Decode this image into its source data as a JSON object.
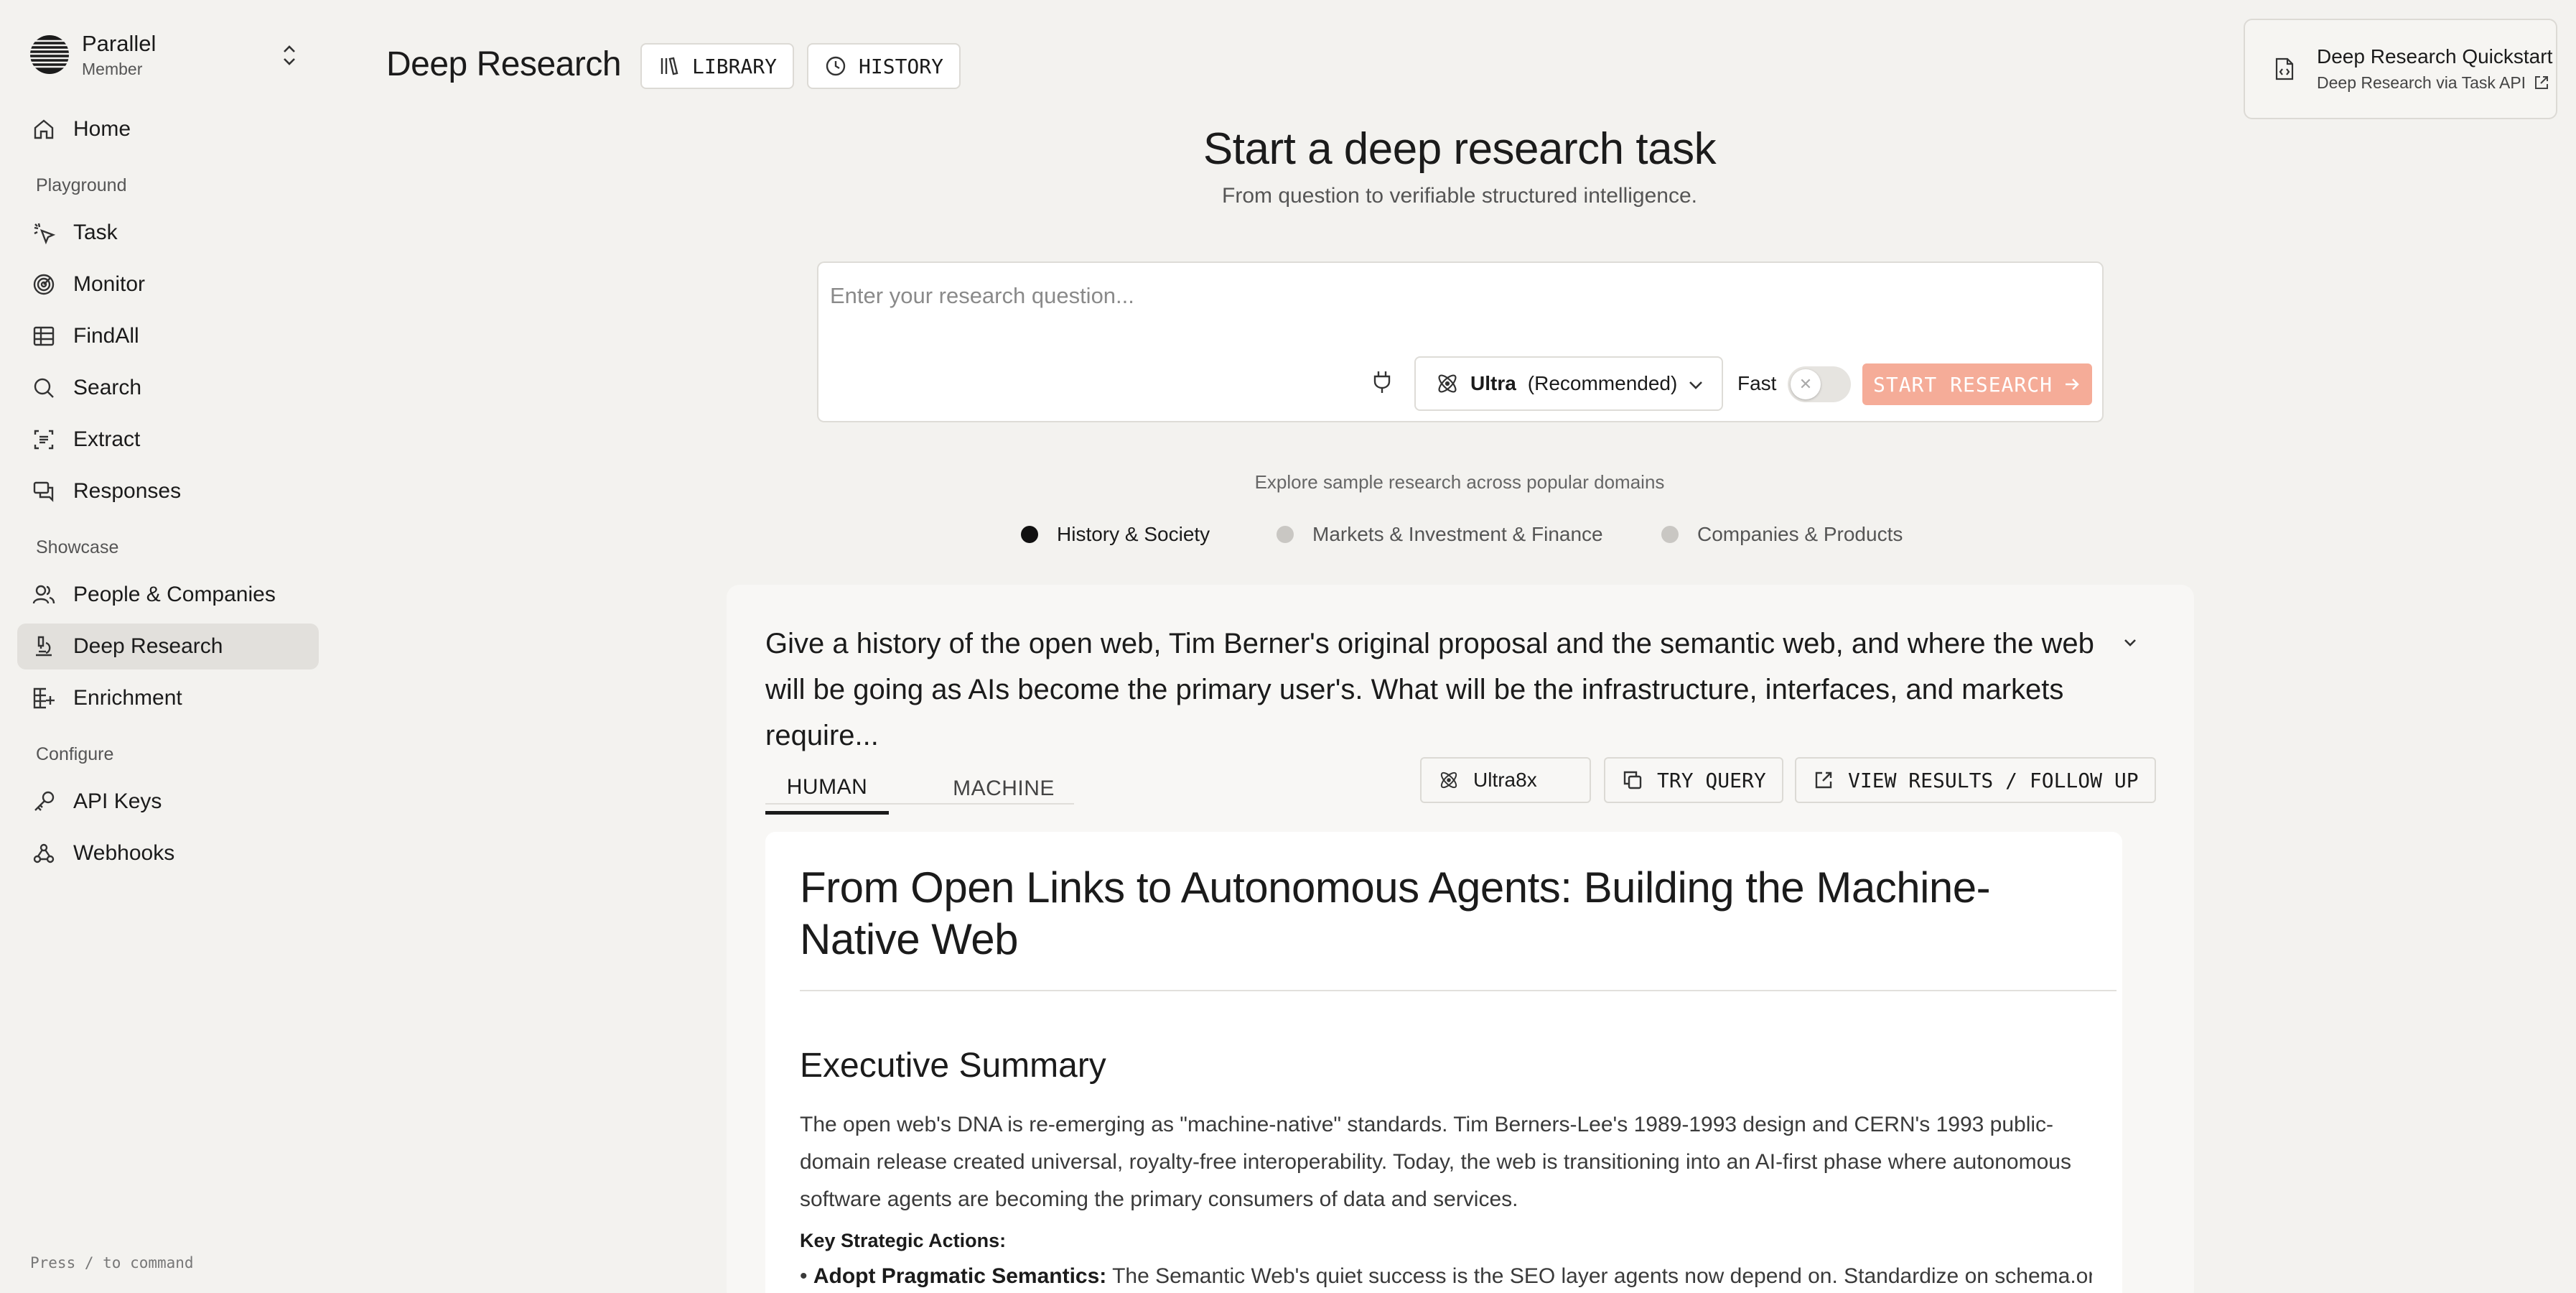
{
  "org": {
    "name": "Parallel",
    "role": "Member"
  },
  "nav": {
    "home": "Home",
    "playground_label": "Playground",
    "task": "Task",
    "monitor": "Monitor",
    "findall": "FindAll",
    "search": "Search",
    "extract": "Extract",
    "responses": "Responses",
    "showcase_label": "Showcase",
    "people": "People & Companies",
    "deep_research": "Deep Research",
    "enrichment": "Enrichment",
    "configure_label": "Configure",
    "api_keys": "API Keys",
    "webhooks": "Webhooks"
  },
  "command_hint": "Press / to command",
  "header": {
    "title": "Deep Research",
    "library": "LIBRARY",
    "history": "HISTORY"
  },
  "quickstart": {
    "title": "Deep Research Quickstart",
    "subtitle": "Deep Research via Task API"
  },
  "hero": {
    "title": "Start a deep research task",
    "subtitle": "From question to verifiable structured intelligence."
  },
  "query": {
    "placeholder": "Enter your research question...",
    "value": "",
    "model": "Ultra",
    "model_note": "(Recommended)",
    "fast_label": "Fast",
    "fast_enabled": false,
    "start": "START RESEARCH"
  },
  "explore": {
    "label": "Explore sample research across popular domains",
    "domains": [
      {
        "label": "History & Society",
        "active": true
      },
      {
        "label": "Markets & Investment & Finance",
        "active": false
      },
      {
        "label": "Companies & Products",
        "active": false
      }
    ]
  },
  "sample": {
    "question": "Give a history of the open web, Tim Berner's original proposal and the semantic web, and where the web will be going as AIs become the primary user's. What will be the infrastructure, interfaces, and markets require...",
    "tabs": [
      "HUMAN",
      "MACHINE"
    ],
    "processor": "Ultra8x",
    "try_query": "TRY QUERY",
    "view_results": "VIEW RESULTS / FOLLOW UP",
    "report": {
      "title": "From Open Links to Autonomous Agents: Building the Machine-Native Web",
      "section": "Executive Summary",
      "paragraph": "The open web's DNA is re-emerging as \"machine-native\" standards. Tim Berners-Lee's 1989-1993 design and CERN's 1993 public-domain release created universal, royalty-free interoperability. Today, the web is transitioning into an AI-first phase where autonomous software agents are becoming the primary consumers of data and services.",
      "actions_label": "Key Strategic Actions:",
      "bullet_bold": "Adopt Pragmatic Semantics:",
      "bullet_text": " The Semantic Web's quiet success is the SEO layer agents now depend on. Standardize on schema.org"
    }
  }
}
